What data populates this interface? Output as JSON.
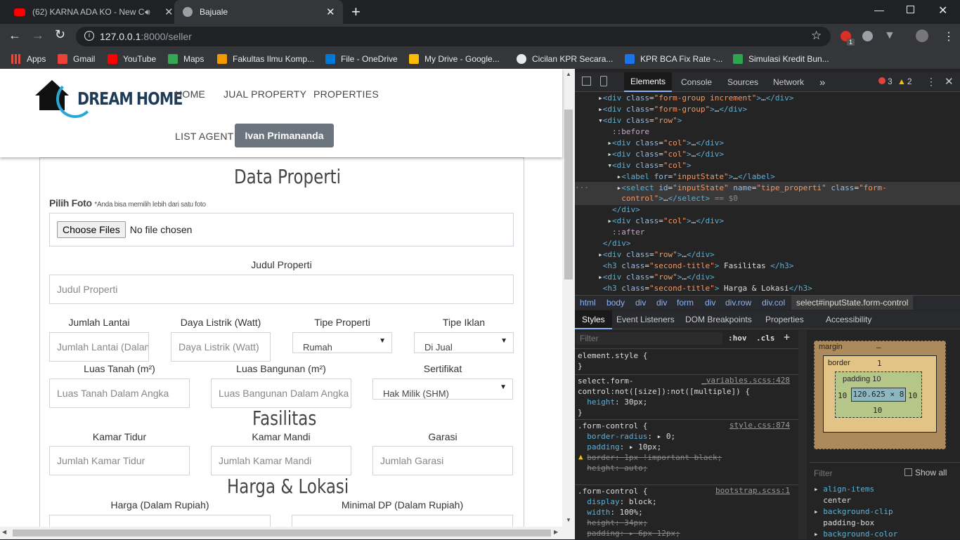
{
  "browser": {
    "tabs": [
      {
        "title": "(62) KARNA ADA KO - New C",
        "active": false
      },
      {
        "title": "Bajuale",
        "active": true
      }
    ],
    "url_host": "127.0.0.1",
    "url_path": ":8000/seller",
    "new_tab": "+",
    "badge": "1"
  },
  "bookmarks": [
    {
      "label": "Apps",
      "color": "#e8eaed"
    },
    {
      "label": "Gmail",
      "color": "#ea4335"
    },
    {
      "label": "YouTube",
      "color": "#ff0000"
    },
    {
      "label": "Maps",
      "color": "#34a853"
    },
    {
      "label": "Fakultas Ilmu Komp...",
      "color": "#f29900"
    },
    {
      "label": "File - OneDrive",
      "color": "#0078d4"
    },
    {
      "label": "My Drive - Google...",
      "color": "#fbbc04"
    },
    {
      "label": "Cicilan KPR Secara...",
      "color": "#e8eaed"
    },
    {
      "label": "KPR BCA Fix Rate -...",
      "color": "#1a73e8"
    },
    {
      "label": "Simulasi Kredit Bun...",
      "color": "#2ea44f"
    }
  ],
  "site": {
    "logo_a": "DREAM",
    "logo_b": "HOME",
    "nav": [
      "HOME",
      "JUAL PROPERTY",
      "PROPERTIES",
      "LIST AGENT"
    ],
    "user": "Ivan Primananda"
  },
  "form": {
    "title": "Data Properti",
    "foto_label": "Pilih Foto",
    "foto_note": "*Anda bisa memilih lebih dari satu foto",
    "choose_btn": "Choose Files",
    "no_file": "No file chosen",
    "judul_label": "Judul Properti",
    "judul_ph": "Judul Properti",
    "lantai_label": "Jumlah Lantai",
    "lantai_ph": "Jumlah Lantai (Dalam Angka)",
    "daya_label": "Daya Listrik (Watt)",
    "daya_ph": "Daya Listrik (Watt)",
    "tipe_label": "Tipe Properti",
    "tipe_val": "Rumah",
    "iklan_label": "Tipe Iklan",
    "iklan_val": "Di Jual",
    "lt_label": "Luas Tanah (m²)",
    "lt_ph": "Luas Tanah Dalam Angka",
    "lb_label": "Luas Bangunan (m²)",
    "lb_ph": "Luas Bangunan Dalam Angka",
    "sert_label": "Sertifikat",
    "sert_val": "Hak Milik (SHM)",
    "fasilitas": "Fasilitas",
    "kt_label": "Kamar Tidur",
    "kt_ph": "Jumlah Kamar Tidur",
    "km_label": "Kamar Mandi",
    "km_ph": "Jumlah Kamar Mandi",
    "garasi_label": "Garasi",
    "garasi_ph": "Jumlah Garasi",
    "harga_title": "Harga & Lokasi",
    "harga_label": "Harga (Dalam Rupiah)",
    "dp_label": "Minimal DP (Dalam Rupiah)"
  },
  "devtools": {
    "tabs": [
      "Elements",
      "Console",
      "Sources",
      "Network",
      "»"
    ],
    "errors": "3",
    "warnings": "2",
    "crumbs": [
      "html",
      "body",
      "div",
      "div",
      "form",
      "div",
      "div.row",
      "div.col",
      "select#inputState.form-control"
    ],
    "style_tabs": [
      "Styles",
      "Event Listeners",
      "DOM Breakpoints",
      "Properties",
      "Accessibility"
    ],
    "filter": "Filter",
    "hov": ":hov",
    "cls": ".cls",
    "show_all": "Show all",
    "box": {
      "margin": "margin",
      "margin_val": "–",
      "border": "border",
      "border_val": "1",
      "padding": "padding 10",
      "pad_side": "10",
      "content": "120.625 × 8",
      "bottom": "10"
    }
  }
}
